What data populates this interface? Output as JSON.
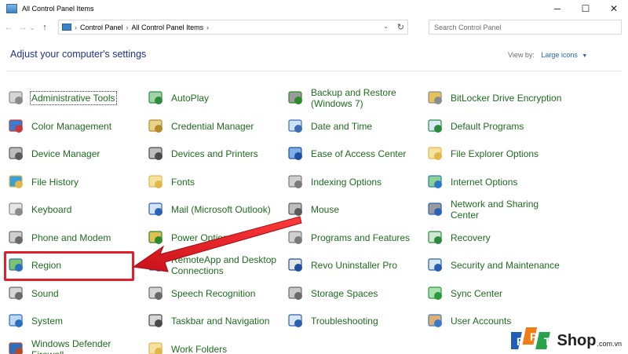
{
  "window": {
    "title": "All Control Panel Items",
    "controls": {
      "minimize": "─",
      "maximize": "☐",
      "close": "✕"
    }
  },
  "nav": {
    "back": "←",
    "forward": "→",
    "recent": "⌄",
    "up": "↑",
    "breadcrumbs": [
      "Control Panel",
      "All Control Panel Items"
    ],
    "separator": "›",
    "dropdown": "⌄",
    "refresh": "↻",
    "search_placeholder": "Search Control Panel"
  },
  "header": {
    "title": "Adjust your computer's settings",
    "view_by_label": "View by:",
    "view_by_value": "Large icons",
    "view_by_arrow": "▼"
  },
  "items": [
    {
      "label": "Administrative Tools",
      "icon": "admin-tools-icon"
    },
    {
      "label": "AutoPlay",
      "icon": "autoplay-icon"
    },
    {
      "label": "Backup and Restore (Windows 7)",
      "icon": "backup-icon"
    },
    {
      "label": "BitLocker Drive Encryption",
      "icon": "bitlocker-icon"
    },
    {
      "label": "Color Management",
      "icon": "color-management-icon"
    },
    {
      "label": "Credential Manager",
      "icon": "credential-icon"
    },
    {
      "label": "Date and Time",
      "icon": "date-time-icon"
    },
    {
      "label": "Default Programs",
      "icon": "default-programs-icon"
    },
    {
      "label": "Device Manager",
      "icon": "device-manager-icon"
    },
    {
      "label": "Devices and Printers",
      "icon": "printer-icon"
    },
    {
      "label": "Ease of Access Center",
      "icon": "ease-of-access-icon"
    },
    {
      "label": "File Explorer Options",
      "icon": "folder-options-icon"
    },
    {
      "label": "File History",
      "icon": "file-history-icon"
    },
    {
      "label": "Fonts",
      "icon": "fonts-icon"
    },
    {
      "label": "Indexing Options",
      "icon": "indexing-icon"
    },
    {
      "label": "Internet Options",
      "icon": "internet-icon"
    },
    {
      "label": "Keyboard",
      "icon": "keyboard-icon"
    },
    {
      "label": "Mail (Microsoft Outlook)",
      "icon": "mail-icon"
    },
    {
      "label": "Mouse",
      "icon": "mouse-icon"
    },
    {
      "label": "Network and Sharing Center",
      "icon": "network-icon"
    },
    {
      "label": "Phone and Modem",
      "icon": "phone-icon"
    },
    {
      "label": "Power Options",
      "icon": "power-icon"
    },
    {
      "label": "Programs and Features",
      "icon": "programs-icon"
    },
    {
      "label": "Recovery",
      "icon": "recovery-icon"
    },
    {
      "label": "Region",
      "icon": "region-icon"
    },
    {
      "label": "RemoteApp and Desktop Connections",
      "icon": "remoteapp-icon"
    },
    {
      "label": "Revo Uninstaller Pro",
      "icon": "revo-icon"
    },
    {
      "label": "Security and Maintenance",
      "icon": "security-flag-icon"
    },
    {
      "label": "Sound",
      "icon": "sound-icon"
    },
    {
      "label": "Speech Recognition",
      "icon": "microphone-icon"
    },
    {
      "label": "Storage Spaces",
      "icon": "storage-icon"
    },
    {
      "label": "Sync Center",
      "icon": "sync-icon"
    },
    {
      "label": "System",
      "icon": "system-icon"
    },
    {
      "label": "Taskbar and Navigation",
      "icon": "taskbar-icon"
    },
    {
      "label": "Troubleshooting",
      "icon": "troubleshooting-icon"
    },
    {
      "label": "User Accounts",
      "icon": "user-accounts-icon"
    },
    {
      "label": "Windows Defender Firewall",
      "icon": "firewall-icon"
    },
    {
      "label": "Work Folders",
      "icon": "work-folders-icon"
    }
  ],
  "watermark": {
    "brand": "Shop",
    "domain": ".com.vn"
  },
  "colors": {
    "link": "#1e6b1e",
    "heading": "#1e3287",
    "highlight": "#e0202a",
    "accent": "#1e66b4"
  }
}
